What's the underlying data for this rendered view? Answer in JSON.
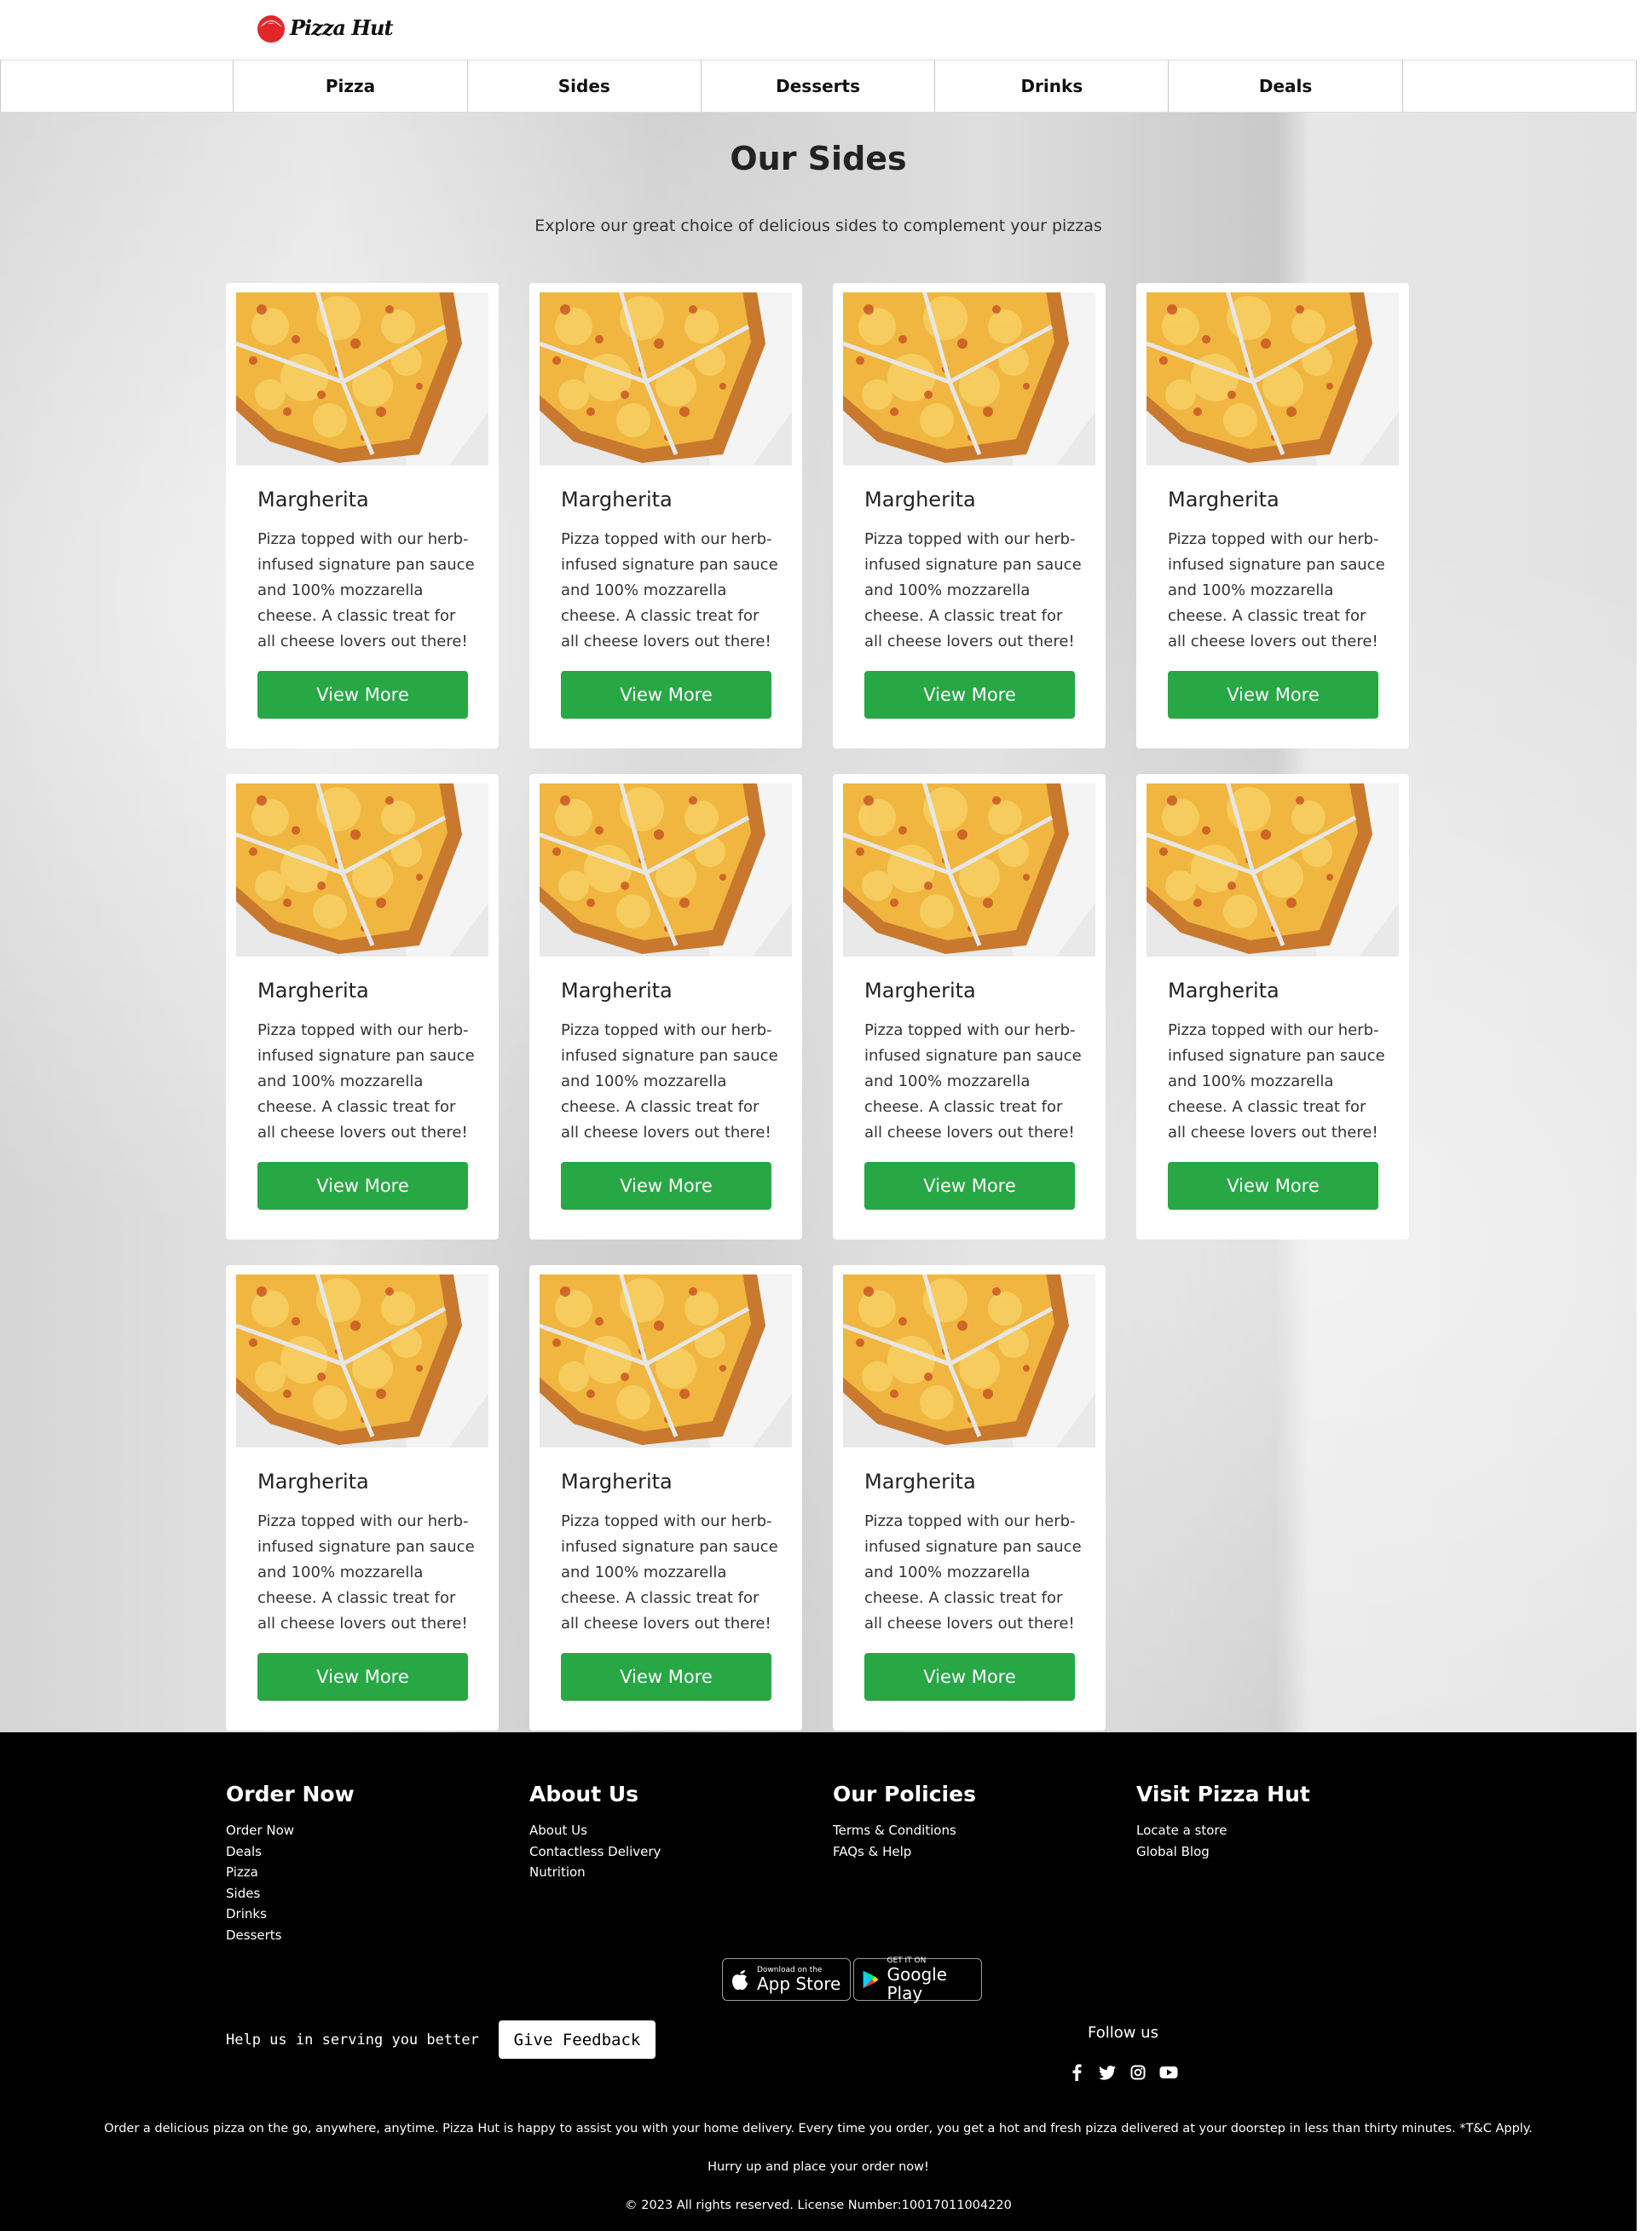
{
  "brand": {
    "logo_text": "Pizza Hut",
    "logo_icon": "pizza-hut-logo-icon",
    "brand_red": "#e3262a"
  },
  "nav": {
    "items": [
      "",
      "Pizza",
      "Sides",
      "Desserts",
      "Drinks",
      "Deals",
      ""
    ]
  },
  "main": {
    "title": "Our Sides",
    "subtitle": "Explore our great choice of delicious sides to complement your pizzas"
  },
  "products": [
    {
      "name": "Margherita",
      "description": "Pizza topped with our herb-infused signature pan sauce and 100% mozzarella cheese. A classic treat for all cheese lovers out there!",
      "button": "View More"
    },
    {
      "name": "Margherita",
      "description": "Pizza topped with our herb-infused signature pan sauce and 100% mozzarella cheese. A classic treat for all cheese lovers out there!",
      "button": "View More"
    },
    {
      "name": "Margherita",
      "description": "Pizza topped with our herb-infused signature pan sauce and 100% mozzarella cheese. A classic treat for all cheese lovers out there!",
      "button": "View More"
    },
    {
      "name": "Margherita",
      "description": "Pizza topped with our herb-infused signature pan sauce and 100% mozzarella cheese. A classic treat for all cheese lovers out there!",
      "button": "View More"
    },
    {
      "name": "Margherita",
      "description": "Pizza topped with our herb-infused signature pan sauce and 100% mozzarella cheese. A classic treat for all cheese lovers out there!",
      "button": "View More"
    },
    {
      "name": "Margherita",
      "description": "Pizza topped with our herb-infused signature pan sauce and 100% mozzarella cheese. A classic treat for all cheese lovers out there!",
      "button": "View More"
    },
    {
      "name": "Margherita",
      "description": "Pizza topped with our herb-infused signature pan sauce and 100% mozzarella cheese. A classic treat for all cheese lovers out there!",
      "button": "View More"
    },
    {
      "name": "Margherita",
      "description": "Pizza topped with our herb-infused signature pan sauce and 100% mozzarella cheese. A classic treat for all cheese lovers out there!",
      "button": "View More"
    },
    {
      "name": "Margherita",
      "description": "Pizza topped with our herb-infused signature pan sauce and 100% mozzarella cheese. A classic treat for all cheese lovers out there!",
      "button": "View More"
    },
    {
      "name": "Margherita",
      "description": "Pizza topped with our herb-infused signature pan sauce and 100% mozzarella cheese. A classic treat for all cheese lovers out there!",
      "button": "View More"
    },
    {
      "name": "Margherita",
      "description": "Pizza topped with our herb-infused signature pan sauce and 100% mozzarella cheese. A classic treat for all cheese lovers out there!",
      "button": "View More"
    }
  ],
  "footer": {
    "columns": [
      {
        "title": "Order Now",
        "links": [
          "Order Now",
          "Deals",
          "Pizza",
          "Sides",
          "Drinks",
          "Desserts"
        ]
      },
      {
        "title": "About Us",
        "links": [
          "About Us",
          "Contactless Delivery",
          "Nutrition"
        ]
      },
      {
        "title": "Our Policies",
        "links": [
          "Terms & Conditions",
          "FAQs & Help"
        ]
      },
      {
        "title": "Visit Pizza Hut",
        "links": [
          "Locate a store",
          "Global Blog"
        ]
      }
    ],
    "app_store": {
      "small": "Download on the",
      "big": "App Store",
      "icon": "apple-icon"
    },
    "google_play": {
      "small": "GET IT ON",
      "big": "Google Play",
      "icon": "google-play-icon"
    },
    "help_text": "Help us in serving you better",
    "feedback_button": "Give Feedback",
    "follow_us": "Follow us",
    "social_icons": [
      "facebook-icon",
      "twitter-icon",
      "instagram-icon",
      "youtube-icon"
    ],
    "tagline": "Order a delicious pizza on the go, anywhere, anytime. Pizza Hut is happy to assist you with your home delivery. Every time you order, you get a hot and fresh pizza delivered at your doorstep in less than thirty minutes. *T&C Apply.",
    "hurry": "Hurry up and place your order now!",
    "copyright": "© 2023 All rights reserved. License Number:10017011004220"
  },
  "colors": {
    "button_green": "#28a745",
    "footer_bg": "#000000"
  }
}
